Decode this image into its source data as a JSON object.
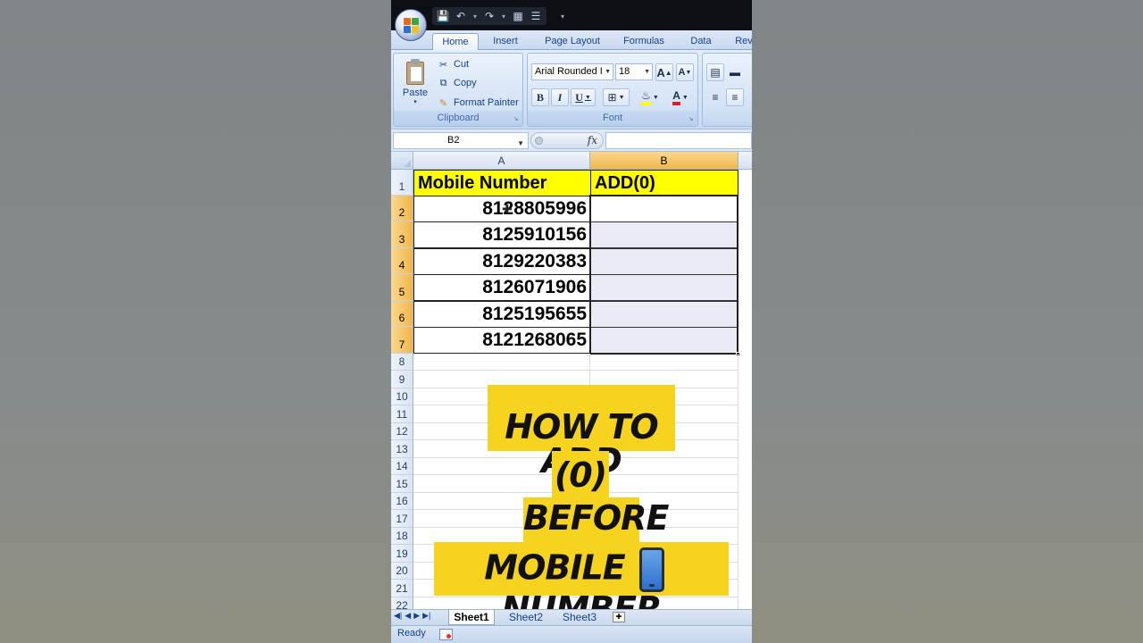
{
  "app": {
    "ribbon_tabs": [
      "Home",
      "Insert",
      "Page Layout",
      "Formulas",
      "Data",
      "Rev"
    ],
    "active_tab": "Home"
  },
  "clipboard": {
    "paste_label": "Paste",
    "cut_label": "Cut",
    "copy_label": "Copy",
    "format_painter_label": "Format Painter",
    "group_label": "Clipboard"
  },
  "font": {
    "font_name": "Arial Rounded I",
    "font_size": "18",
    "bold": "B",
    "italic": "I",
    "underline": "U",
    "grow": "A",
    "shrink": "A",
    "font_color_letter": "A",
    "group_label": "Font"
  },
  "formula_bar": {
    "name_box": "B2",
    "fx": "fx",
    "formula": ""
  },
  "sheet": {
    "columns": [
      "A",
      "B"
    ],
    "rows": [
      "1",
      "2",
      "3",
      "4",
      "5",
      "6",
      "7",
      "8",
      "9",
      "10",
      "11",
      "12",
      "13",
      "14",
      "15",
      "16",
      "17",
      "18",
      "19",
      "20",
      "21",
      "22"
    ],
    "header_a": "Mobile Number",
    "header_b": "ADD(0)",
    "numbers": [
      "8128805996",
      "8125910156",
      "8129220383",
      "8126071906",
      "8125195655",
      "8121268065"
    ],
    "header_fill": "#ffff00"
  },
  "overlay": {
    "line1": "HOW TO ADD",
    "line2": "(0)",
    "line3": "BEFORE",
    "line4a": "MOBILE",
    "line4b": "NUMBER",
    "phone_icon": "mobile-phone-icon",
    "accent": "#f6d31f"
  },
  "sheet_tabs": [
    "Sheet1",
    "Sheet2",
    "Sheet3"
  ],
  "active_sheet": "Sheet1",
  "status": {
    "text": "Ready"
  }
}
